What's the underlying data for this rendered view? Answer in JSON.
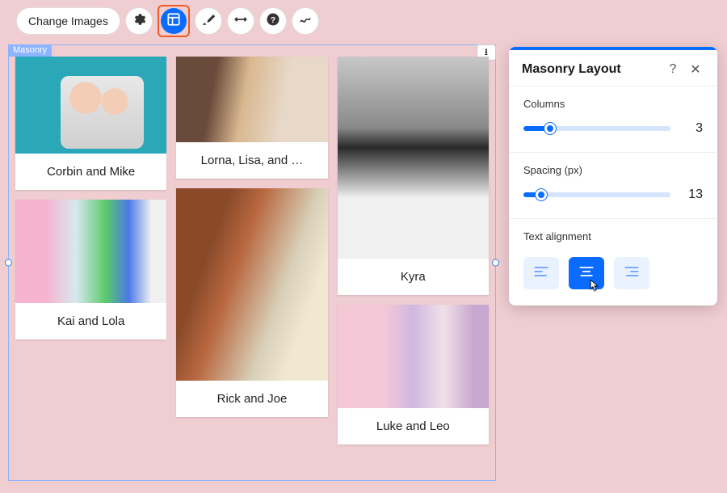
{
  "toolbar": {
    "change_images_label": "Change Images",
    "icons": {
      "settings": "gear-icon",
      "layout": "layout-icon",
      "design": "brush-icon",
      "resize": "resize-horizontal-icon",
      "help": "help-icon",
      "animation": "squiggle-icon"
    }
  },
  "gallery": {
    "tag_label": "Masonry",
    "items": [
      {
        "caption": "Corbin and Mike"
      },
      {
        "caption": "Lorna, Lisa, and …"
      },
      {
        "caption": "Kai and Lola"
      },
      {
        "caption": "Rick and Joe"
      },
      {
        "caption": "Kyra"
      },
      {
        "caption": "Luke and Leo"
      }
    ]
  },
  "panel": {
    "title": "Masonry Layout",
    "columns": {
      "label": "Columns",
      "value": 3,
      "fill_pct": 18
    },
    "spacing": {
      "label": "Spacing (px)",
      "value": 13,
      "fill_pct": 12
    },
    "text_align": {
      "label": "Text alignment",
      "selected": "center",
      "options": [
        "left",
        "center",
        "right"
      ]
    }
  }
}
